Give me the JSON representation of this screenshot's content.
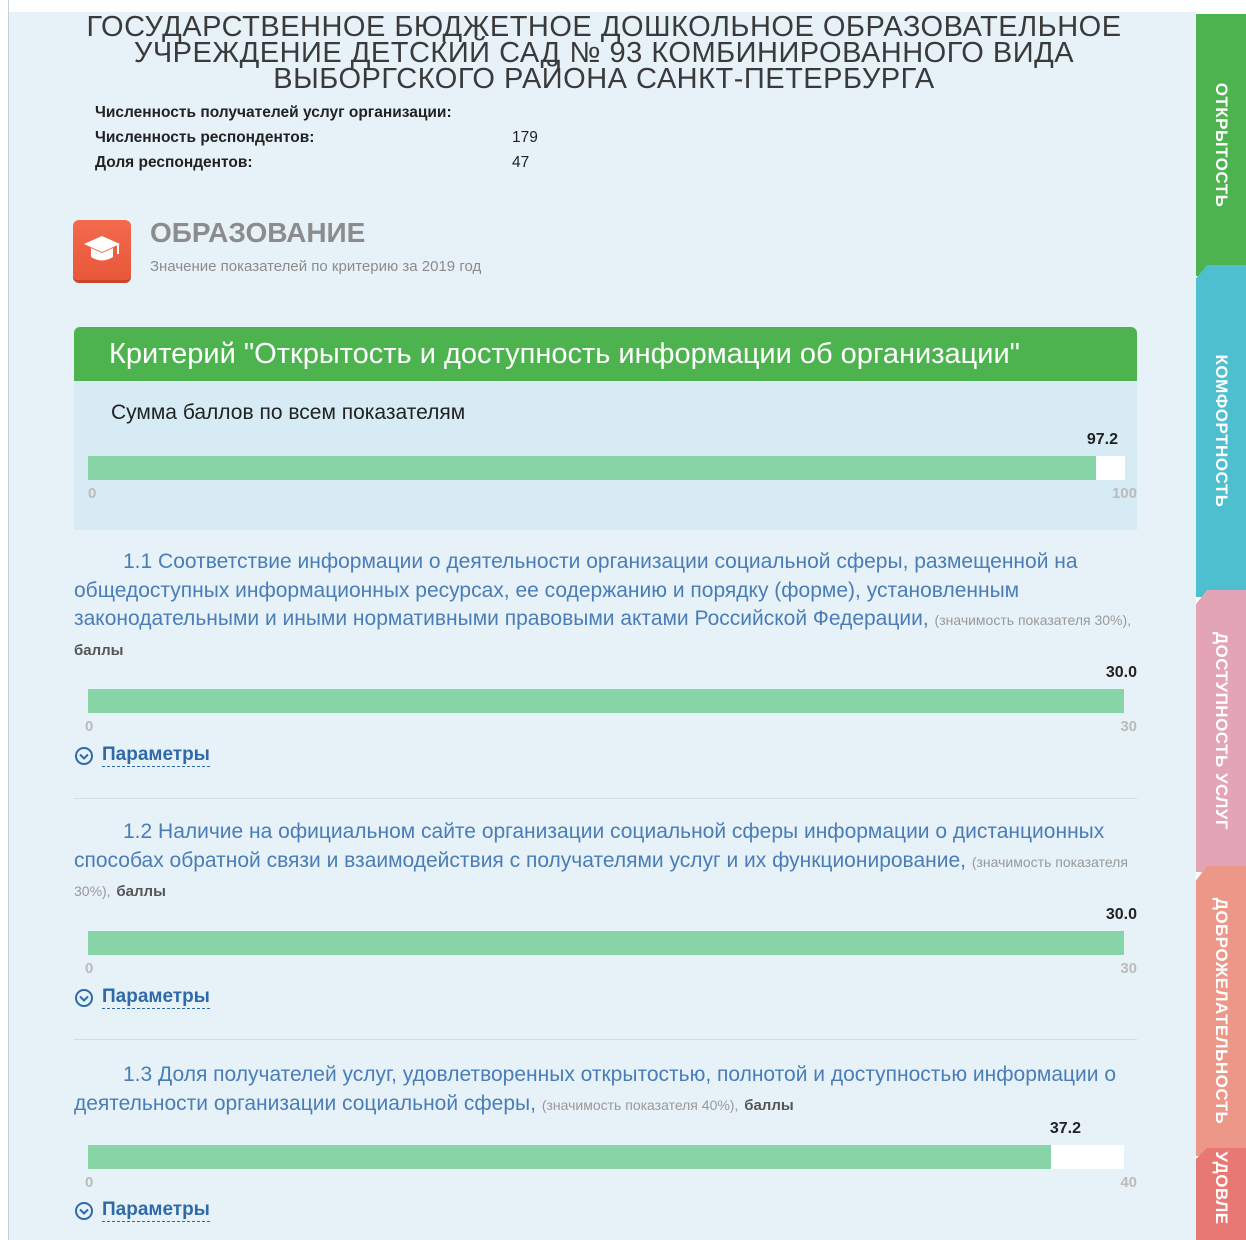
{
  "org": {
    "title": "ГОСУДАРСТВЕННОЕ БЮДЖЕТНОЕ ДОШКОЛЬНОЕ ОБРАЗОВАТЕЛЬНОЕ УЧРЕЖДЕНИЕ ДЕТСКИЙ САД № 93 КОМБИНИРОВАННОГО ВИДА ВЫБОРГСКОГО РАЙОНА САНКТ-ПЕТЕРБУРГА"
  },
  "stats": [
    {
      "label": "Численность получателей услуг организации:",
      "value": ""
    },
    {
      "label": "Численность респондентов:",
      "value": "179"
    },
    {
      "label": "Доля респондентов:",
      "value": "47"
    }
  ],
  "section": {
    "title": "ОБРАЗОВАНИЕ",
    "subtitle": "Значение показателей по критерию за 2019 год",
    "icon": "graduation-cap-icon"
  },
  "criterion": {
    "title": "Критерий \"Открытость и доступность информации об организации\"",
    "sum_label": "Сумма баллов по всем показателям",
    "sum": {
      "value": "97.2",
      "min": "0",
      "max": "100",
      "fraction": 0.972
    }
  },
  "indicators": [
    {
      "text": "1.1 Соответствие информации о деятельности организации социальной сферы, размещенной на общедоступных информационных ресурсах, ее содержанию и порядку (форме), установленным законодательными и иными нормативными правовыми актами Российской Федерации,",
      "weight": "(значимость показателя 30%),",
      "unit": "баллы",
      "value": "30.0",
      "min": "0",
      "max": "30",
      "fraction": 1.0,
      "params_label": "Параметры"
    },
    {
      "text": "1.2 Наличие на официальном сайте организации социальной сферы информации о дистанционных способах обратной связи и взаимодействия с получателями услуг и их функционирование,",
      "weight": "(значимость показателя 30%),",
      "unit": "баллы",
      "value": "30.0",
      "min": "0",
      "max": "30",
      "fraction": 1.0,
      "params_label": "Параметры"
    },
    {
      "text": "1.3 Доля получателей услуг, удовлетворенных открытостью, полнотой и доступностью информации о деятельности организации социальной сферы,",
      "weight": "(значимость показателя 40%),",
      "unit": "баллы",
      "value": "37.2",
      "min": "0",
      "max": "40",
      "fraction": 0.93,
      "params_label": "Параметры"
    }
  ],
  "side_tabs": [
    {
      "label": "ОТКРЫТОСТЬ",
      "color": "#4db34f"
    },
    {
      "label": "КОМФОРТНОСТЬ",
      "color": "#4dbfcf"
    },
    {
      "label": "ДОСТУПНОСТЬ УСЛУГ",
      "color": "#e3a4b5"
    },
    {
      "label": "ДОБРОЖЕЛАТЕЛЬНОСТЬ",
      "color": "#ec9787"
    },
    {
      "label": "УДОВЛЕ",
      "color": "#e87873"
    }
  ],
  "colors": {
    "bar_fill": "#87d5a7",
    "link": "#2f6aa8",
    "indicator_text": "#4a7db8"
  }
}
